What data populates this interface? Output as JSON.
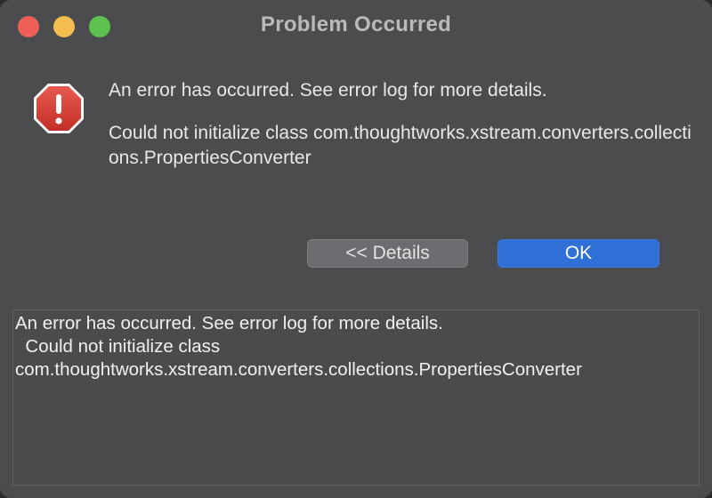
{
  "window": {
    "title": "Problem Occurred"
  },
  "dialog": {
    "icon": "error-octagon-icon",
    "primary_message": "An error has occurred. See error log for more details.",
    "secondary_message": "Could not initialize class com.thoughtworks.xstream.converters.collections.PropertiesConverter",
    "buttons": {
      "details_label": "<< Details",
      "ok_label": "OK"
    }
  },
  "details": {
    "text": "An error has occurred. See error log for more details.\n  Could not initialize class\ncom.thoughtworks.xstream.converters.collections.PropertiesConverter"
  },
  "colors": {
    "error_red": "#d9433a",
    "ok_blue": "#2f6fd6",
    "window_bg": "#4a4c4e"
  }
}
